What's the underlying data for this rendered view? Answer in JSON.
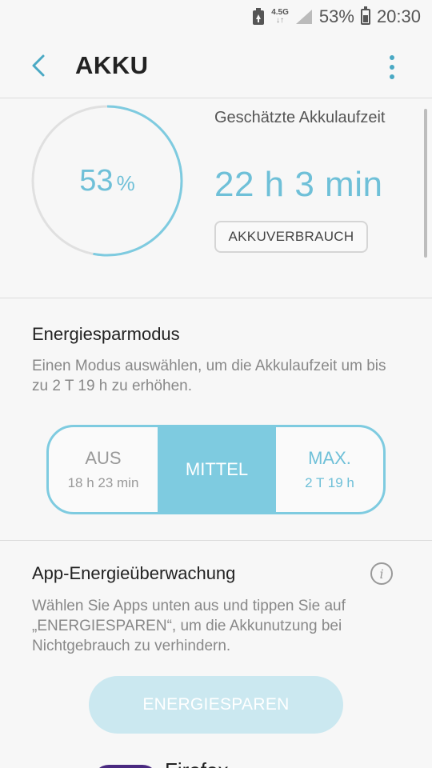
{
  "status_bar": {
    "network": "4.5G",
    "battery_percent_text": "53%",
    "time": "20:30"
  },
  "header": {
    "title": "AKKU"
  },
  "battery": {
    "level_number": "53",
    "level_unit": "%",
    "level_fraction": 0.53,
    "estimated_label": "Geschätzte Akkulaufzeit",
    "estimated_value": "22 h 3 min",
    "usage_button": "AKKUVERBRAUCH"
  },
  "power_saving": {
    "title": "Energiesparmodus",
    "description": "Einen Modus auswählen, um die Akkulaufzeit um bis zu 2 T 19 h  zu erhöhen.",
    "modes": [
      {
        "name": "AUS",
        "time": "18 h 23 min"
      },
      {
        "name": "MITTEL",
        "time": ""
      },
      {
        "name": "MAX.",
        "time": "2 T 19 h"
      }
    ],
    "selected": "MITTEL"
  },
  "app_monitor": {
    "title": "App-Energieüberwachung",
    "description": "Wählen Sie Apps unten aus und tippen Sie auf „ENERGIESPAREN“, um die Akkunutzung bei Nichtgebrauch zu verhindern.",
    "save_button": "ENERGIESPAREN",
    "partial_app_name": "Firefox"
  },
  "colors": {
    "accent": "#6fc0d8",
    "accent_fill": "#7ecbe0",
    "disabled_button": "#cbe8f0"
  }
}
